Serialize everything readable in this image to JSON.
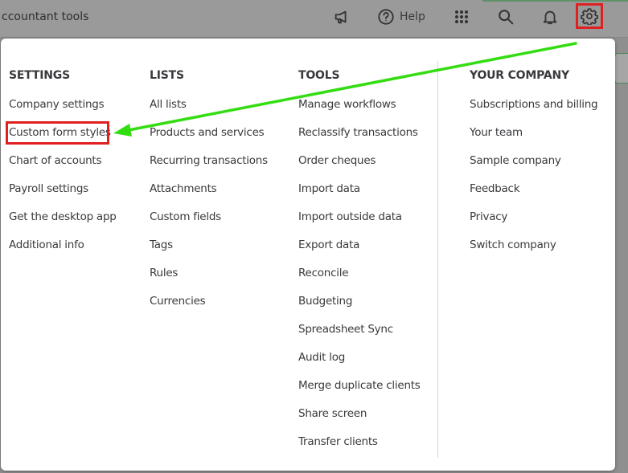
{
  "topbar": {
    "title": "ccountant tools",
    "help_label": "Help",
    "icons": [
      "megaphone-icon",
      "help-icon",
      "apps-grid-icon",
      "search-icon",
      "bell-icon",
      "gear-icon"
    ]
  },
  "columns": [
    {
      "heading": "SETTINGS",
      "items": [
        "Company settings",
        "Custom form styles",
        "Chart of accounts",
        "Payroll settings",
        "Get the desktop app",
        "Additional info"
      ]
    },
    {
      "heading": "LISTS",
      "items": [
        "All lists",
        "Products and services",
        "Recurring transactions",
        "Attachments",
        "Custom fields",
        "Tags",
        "Rules",
        "Currencies"
      ]
    },
    {
      "heading": "TOOLS",
      "items": [
        "Manage workflows",
        "Reclassify transactions",
        "Order cheques",
        "Import data",
        "Import outside data",
        "Export data",
        "Reconcile",
        "Budgeting",
        "Spreadsheet Sync",
        "Audit log",
        "Merge duplicate clients",
        "Share screen",
        "Transfer clients"
      ]
    },
    {
      "heading": "YOUR COMPANY",
      "items": [
        "Subscriptions and billing",
        "Your team",
        "Sample company",
        "Feedback",
        "Privacy",
        "Switch company"
      ]
    }
  ],
  "colors": {
    "annotation_red": "#e02020",
    "annotation_green": "#33dd11",
    "text": "#393a3d"
  }
}
